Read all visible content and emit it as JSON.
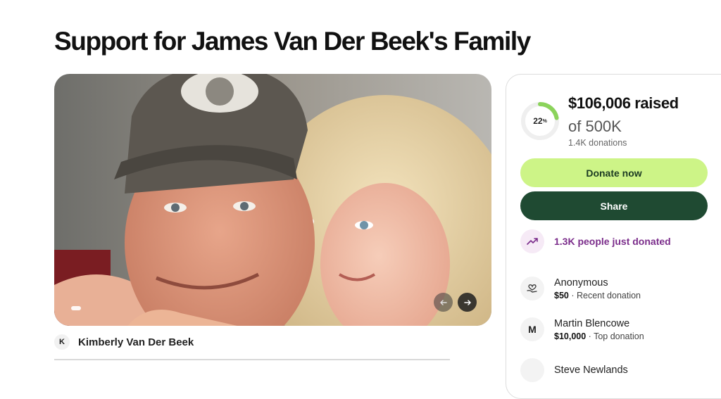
{
  "campaign": {
    "title": "Support for James Van Der Beek's Family",
    "organizer": {
      "initial": "K",
      "name": "Kimberly Van Der Beek"
    }
  },
  "carousel": {
    "prev_icon": "arrow-left-icon",
    "next_icon": "arrow-right-icon"
  },
  "progress": {
    "percent_value": 22,
    "percent_number": "22",
    "percent_sign": "%",
    "raised": "$106,006 raised",
    "goal": "of 500K",
    "donations": "1.4K donations",
    "accent_color": "#8bd35b"
  },
  "actions": {
    "donate_label": "Donate now",
    "share_label": "Share"
  },
  "activity": {
    "trend_text": "1.3K people just donated",
    "trend_icon": "trending-up-icon"
  },
  "donors": [
    {
      "avatar_icon": "heart-hand-icon",
      "name": "Anonymous",
      "amount": "$50",
      "note": " · Recent donation"
    },
    {
      "initial": "M",
      "name": "Martin Blencowe",
      "amount": "$10,000",
      "note": " · Top donation"
    },
    {
      "initial": "",
      "name": "Steve Newlands",
      "amount": "",
      "note": ""
    }
  ]
}
